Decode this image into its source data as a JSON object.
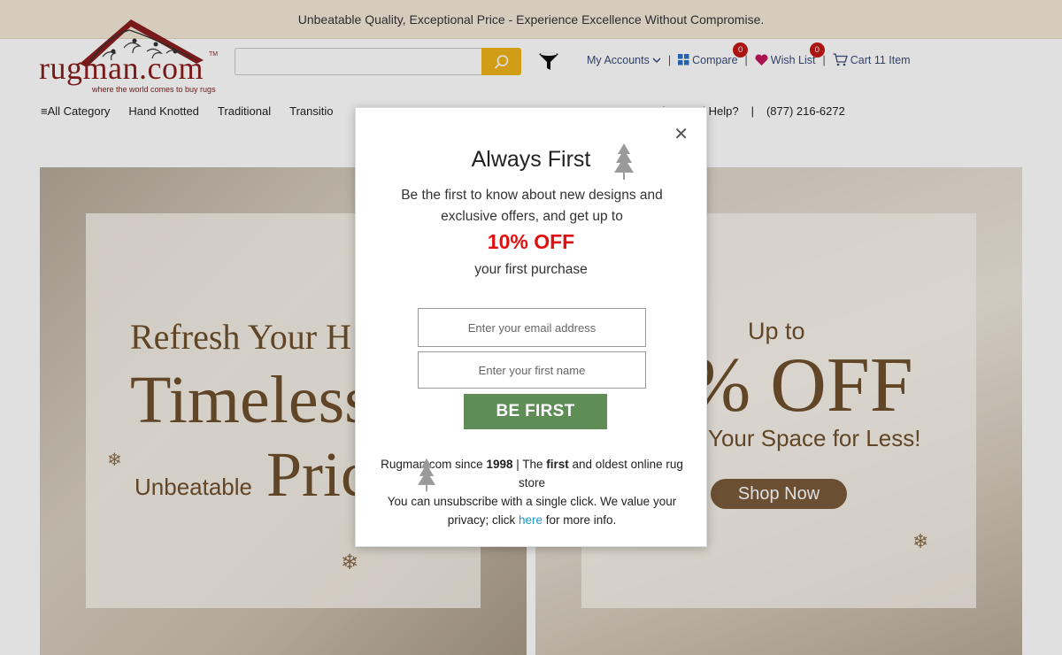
{
  "promo": {
    "text": "Unbeatable Quality, Exceptional Price - Experience Excellence Without Compromise."
  },
  "logo": {
    "word": "rugman.com",
    "tagline": "where the world comes to buy rugs",
    "tm": "TM"
  },
  "header": {
    "my_accounts": "My Accounts",
    "compare": "Compare",
    "compare_count": "0",
    "wishlist": "Wish List",
    "wishlist_count": "0",
    "cart": "Cart 11 Item"
  },
  "nav": {
    "all_category": "All Category",
    "hand_knotted": "Hand Knotted",
    "traditional": "Traditional",
    "transitional": "Transitio",
    "need_help": "Need Help?",
    "phone": "(877) 216-6272"
  },
  "hero_left": {
    "refresh": "Refresh Your H",
    "timeless": "Timeless",
    "unbeatable": "Unbeatable",
    "prices": "Pric"
  },
  "hero_right": {
    "upto": "Up to",
    "off": "% OFF",
    "space": "Your Space for Less!",
    "shop_now": "Shop Now"
  },
  "modal": {
    "title": "Always First",
    "text": "Be the first to know about new designs and exclusive offers, and get up to",
    "off": "10% OFF",
    "purchase": "your first purchase",
    "email_placeholder": "Enter your email address",
    "name_placeholder": "Enter your first name",
    "submit": "BE FIRST",
    "foot_prefix": "Rugman.com since ",
    "foot_year": "1998",
    "foot_mid": " | The ",
    "foot_first": "first",
    "foot_rest": " and oldest online rug store",
    "unsub": "You can unsubscribe with a single click. We value your privacy; click ",
    "here": "here",
    "more_info": " for more info."
  },
  "colors": {
    "promo_bg": "#f3e9d8",
    "search_btn": "#f0b31a",
    "badge": "#c41616",
    "discount_red": "#e01010",
    "submit_green": "#5f8d56",
    "hero_brown": "#6e4f2d",
    "link_blue": "#1a9ad0"
  }
}
